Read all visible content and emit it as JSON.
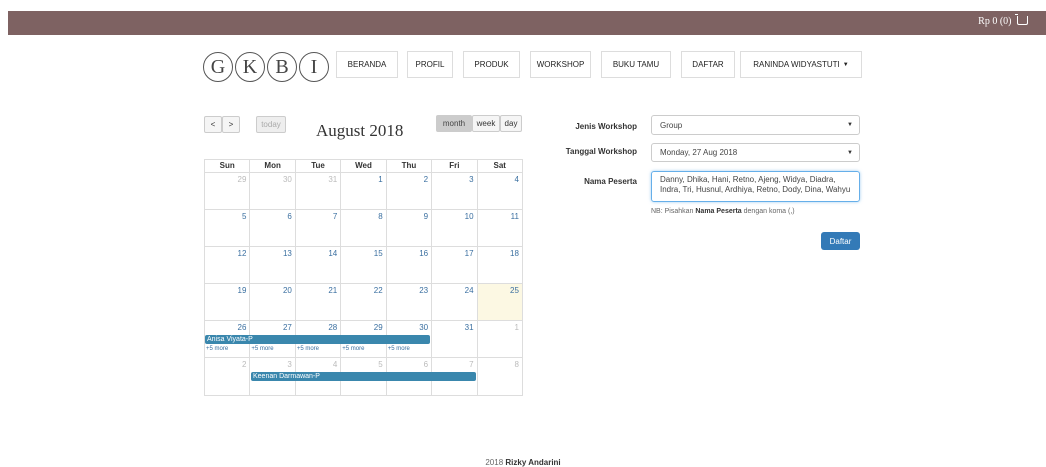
{
  "header": {
    "cart_text": "Rp 0 (0)"
  },
  "logo": {
    "letters": [
      "G",
      "K",
      "B",
      "I"
    ]
  },
  "nav": {
    "items": [
      "BERANDA",
      "PROFIL",
      "PRODUK",
      "WORKSHOP",
      "BUKU TAMU",
      "DAFTAR"
    ],
    "user": "RANINDA WIDYASTUTI"
  },
  "calendar": {
    "prev": "<",
    "next": ">",
    "today": "today",
    "title": "August 2018",
    "views": [
      "month",
      "week",
      "day"
    ],
    "weekdays": [
      "Sun",
      "Mon",
      "Tue",
      "Wed",
      "Thu",
      "Fri",
      "Sat"
    ],
    "weeks": [
      [
        "29",
        "30",
        "31",
        "1",
        "2",
        "3",
        "4"
      ],
      [
        "5",
        "6",
        "7",
        "8",
        "9",
        "10",
        "11"
      ],
      [
        "12",
        "13",
        "14",
        "15",
        "16",
        "17",
        "18"
      ],
      [
        "19",
        "20",
        "21",
        "22",
        "23",
        "24",
        "25"
      ],
      [
        "26",
        "27",
        "28",
        "29",
        "30",
        "31",
        "1"
      ],
      [
        "2",
        "3",
        "4",
        "5",
        "6",
        "7",
        "8"
      ]
    ],
    "events": {
      "first": "Anisa Viyata-P",
      "second": "Keenan Darmawan-P"
    },
    "more_label": "+5 more"
  },
  "form": {
    "jenis_label": "Jenis Workshop",
    "jenis_value": "Group",
    "tanggal_label": "Tanggal Workshop",
    "tanggal_value": "Monday, 27 Aug 2018",
    "nama_label": "Nama Peserta",
    "nama_value": "Danny, Dhika, Hani, Retno, Ajeng, Widya, Diadra, Indra, Tri, Husnul, Ardhiya, Retno, Dody, Dina, Wahyu",
    "note_prefix": "NB: Pisahkan",
    "note_bold": "Nama Peserta",
    "note_suffix": "dengan koma (,)",
    "submit": "Daftar"
  },
  "footer": {
    "year": "2018",
    "author": "Rizky Andarini"
  }
}
